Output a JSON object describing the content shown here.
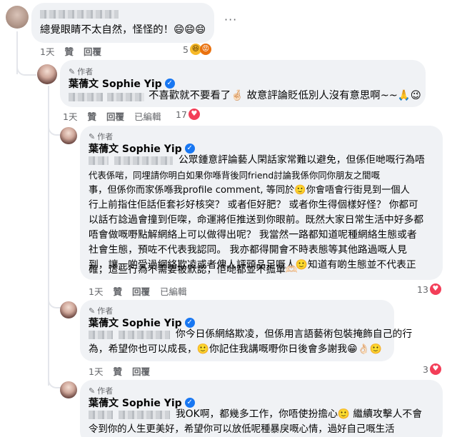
{
  "comments": [
    {
      "text": "總覺眼睛不太自然，怪怪的！😄😄😄",
      "time": "1天",
      "like": "贊",
      "reply": "回覆",
      "reaction_count": "5",
      "more": "···"
    },
    {
      "author_tag": "作者",
      "author": "葉蒨文 Sophie Yip",
      "text": "不喜歡就不要看了🤞🏻 故意評論貶低別人沒有意思啊~~🙏😉",
      "time": "1天",
      "like": "贊",
      "reply": "回覆",
      "edited": "已編輯",
      "reaction_count": "17"
    },
    {
      "author_tag": "作者",
      "author": "葉蒨文 Sophie Yip",
      "lines": [
        "公眾鍾意評論藝人閑話家常難以避免，但係佢哋嘅行為唔",
        "代表係啱，同埋請你明白如果你喺背後同friend討論我係你同你朋友之間嘅",
        "事，但係你而家係喺我profile comment, 等同於🙂你會唔會行街見到一個人",
        "行上前指住佢話佢套衫好核突？ 或者佢好肥？ 或者你生得個樣好怪？ 你都可",
        "以話冇諗過會撞到佢㗎，命運將佢推送到你眼前。既然大家日常生活中好多都",
        "唔會做嘅嘢點解網絡上可以做得出呢？ 我當然一路都知道呢種網絡生態或者",
        "社會生態，預咗不代表我認同。 我亦都得開會不時表態等其他路過嘅人見",
        "到，讓一啲受過網絡欺凌或者俾人評頭品足嘅人🙂知道有啲生態並不代表正",
        "確，這些行為不需要被默認，佢哋都並不孤單🫶🏻"
      ],
      "time": "1天",
      "like": "贊",
      "reply": "回覆",
      "edited": "已編輯",
      "reaction_count": "13"
    },
    {
      "author_tag": "作者",
      "author": "葉蒨文 Sophie Yip",
      "lines": [
        "你今日係網絡欺凌，但係用言語藝術包裝掩飾自己的行",
        "為，希望你也可以成長，🙂你記住我講嘅嘢你日後會多謝我😁👌🏻🙂"
      ],
      "time": "1天",
      "like": "贊",
      "reply": "回覆",
      "reaction_count": "3"
    },
    {
      "author_tag": "作者",
      "author": "葉蒨文 Sophie Yip",
      "lines": [
        "我OK啊，都幾多工作，你唔使扮擔心🙂 繼續攻擊人不會",
        "令到你的人生更美好，希望你可以放低呢種暴戾嘅心情，過好自己嘅生活"
      ]
    }
  ],
  "icons": {
    "author_pencil": "pencil-icon",
    "verified": "verified-badge-icon",
    "reactions": [
      "laugh-reaction-icon",
      "angry-reaction-icon",
      "heart-reaction-icon"
    ]
  },
  "colors": {
    "bubble": "#f0f2f5",
    "meta": "#65676b",
    "verified": "#1877f2"
  }
}
